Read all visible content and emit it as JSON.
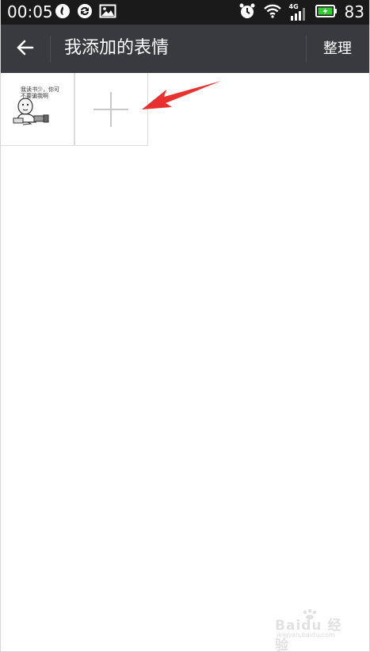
{
  "status_bar": {
    "time": "00:05",
    "signal_label": "4G",
    "battery_level": "83"
  },
  "header": {
    "title": "我添加的表情",
    "manage_label": "整理"
  },
  "stickers": {
    "items": [
      {
        "caption": "我读书少，你可不要骗我啊"
      }
    ]
  },
  "watermark": {
    "brand": "Baidu 经验",
    "url": "jingyan.baidu.com"
  },
  "colors": {
    "status_bar_bg": "#1a1a1a",
    "app_bar_bg": "#393a3f",
    "arrow": "#e8312f"
  },
  "icons": {
    "back": "back-arrow-icon",
    "add": "plus-icon"
  }
}
